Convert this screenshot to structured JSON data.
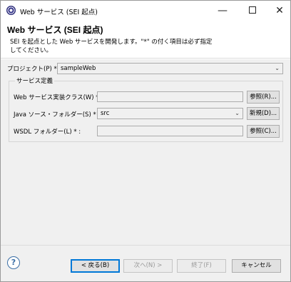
{
  "window": {
    "title": "Web サービス (SEI 起点)",
    "minimize": "—",
    "close": "✕"
  },
  "header": {
    "title": "Web サービス (SEI 起点)",
    "description": "SEI を起点とした Web サービスを開発します。\"*\" の付く項目は必ず指定してください。"
  },
  "project": {
    "label": "プロジェクト(P) * :",
    "value": "sampleWeb"
  },
  "service_group": {
    "title": "サービス定義",
    "impl_class": {
      "label": "Web サービス実装クラス(W) * :",
      "value": "",
      "button": "参照(R)..."
    },
    "source_folder": {
      "label": "Java ソース・フォルダー(S) * :",
      "value": "src",
      "button": "新規(D)..."
    },
    "wsdl_folder": {
      "label": "WSDL フォルダー(L) * :",
      "value": "",
      "button": "参照(C)..."
    }
  },
  "footer": {
    "help_icon": "?",
    "back": "< 戻る(B)",
    "next": "次へ(N) >",
    "finish": "終了(F)",
    "cancel": "キャンセル"
  },
  "colors": {
    "dialog_bg": "#f0f0f0",
    "primary_border": "#0078d7",
    "help_blue": "#3a6ea5"
  }
}
